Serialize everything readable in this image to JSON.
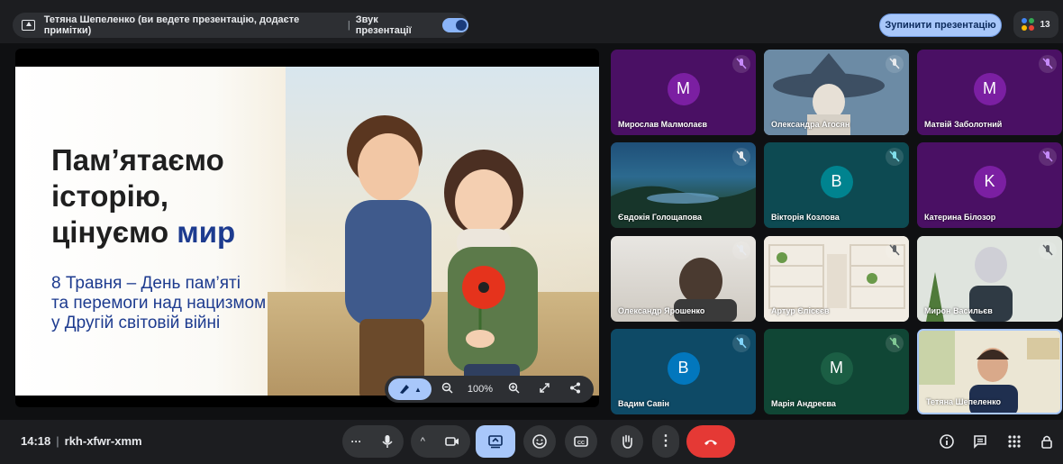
{
  "topbar": {
    "presenting_text": "Тетяна Шепеленко (ви ведете презентацію, додаєте примітки)",
    "separator": "|",
    "audio_label": "Звук презентації",
    "stop_button": "Зупинити презентацію",
    "participant_count": "13"
  },
  "slide": {
    "title_line1": "Пам’ятаємо",
    "title_line2": "історію,",
    "title_line3_prefix": "цінуємо ",
    "title_line3_accent": "мир",
    "subtitle_line1": "8 Травня – День пам’яті",
    "subtitle_line2": "та перемоги над нацизмом",
    "subtitle_line3": "у Другій світовій війні"
  },
  "zoombar": {
    "zoom_percent": "100%"
  },
  "tiles": [
    {
      "name": "Мирослав Малмолаєв",
      "initial": "M"
    },
    {
      "name": "Олександра Агосян",
      "initial": ""
    },
    {
      "name": "Матвій Заболотний",
      "initial": "M"
    },
    {
      "name": "Євдокія Голощапова",
      "initial": ""
    },
    {
      "name": "Вікторія Козлова",
      "initial": "B"
    },
    {
      "name": "Катерина Білозор",
      "initial": "K"
    },
    {
      "name": "Олександр Ярошенко",
      "initial": ""
    },
    {
      "name": "Артур Єлісєєв",
      "initial": ""
    },
    {
      "name": "Мирон Васильєв",
      "initial": ""
    },
    {
      "name": "Вадим Савін",
      "initial": "B"
    },
    {
      "name": "Марія Андреєва",
      "initial": "M"
    },
    {
      "name": "Тетяна Шепеленко",
      "initial": ""
    }
  ],
  "bottombar": {
    "time": "14:18",
    "separator": "|",
    "meeting_code": "rkh-xfwr-xmm"
  },
  "colors": {
    "accent": "#a8c7fa",
    "end_call": "#e53935"
  }
}
